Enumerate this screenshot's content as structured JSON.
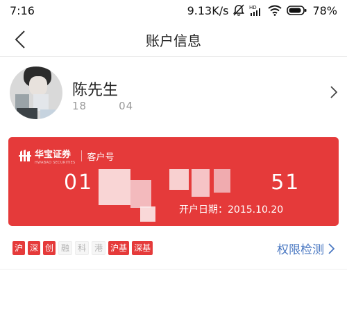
{
  "status_bar": {
    "time": "7:16",
    "network_speed": "9.13K/s",
    "network_type": "HD",
    "battery": "78%",
    "icons": [
      "mute-icon",
      "signal-icon",
      "wifi-icon",
      "battery-icon"
    ]
  },
  "nav": {
    "title": "账户信息",
    "back_icon": "chevron-left-icon"
  },
  "profile": {
    "name": "陈先生",
    "phone_prefix": "18",
    "phone_suffix": "04",
    "chevron_icon": "chevron-right-icon"
  },
  "card": {
    "brand": "华宝证券",
    "brand_en": "HWABAO SECURITIES",
    "id_label": "客户号",
    "account_prefix": "01",
    "account_suffix": "51",
    "open_date": "开户日期：2015.10.20",
    "color": "#e53a3a"
  },
  "permissions": {
    "tags": [
      {
        "label": "沪",
        "enabled": true
      },
      {
        "label": "深",
        "enabled": true
      },
      {
        "label": "创",
        "enabled": true
      },
      {
        "label": "融",
        "enabled": false
      },
      {
        "label": "科",
        "enabled": false
      },
      {
        "label": "港",
        "enabled": false
      },
      {
        "label": "沪基",
        "enabled": true
      },
      {
        "label": "深基",
        "enabled": true
      }
    ],
    "check_link": "权限检测",
    "link_color": "#4a78c2"
  }
}
